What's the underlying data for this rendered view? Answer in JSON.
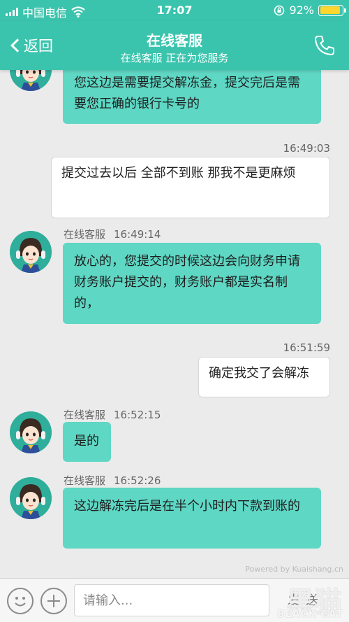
{
  "status_bar": {
    "carrier": "中国电信",
    "time": "17:07",
    "battery": "92%",
    "battery_level": 0.92
  },
  "nav": {
    "back_label": "返回",
    "title": "在线客服",
    "subtitle": "在线客服 正在为您服务"
  },
  "messages": [
    {
      "text": "您这边是需要提交解冻金，提交完后是需要您正确的银行卡号的"
    },
    {
      "time": "16:49:03",
      "text": "提交过去以后 全部不到账 那我不是更麻烦"
    },
    {
      "sender": "在线客服",
      "time": "16:49:14",
      "text": "放心的，您提交的时候这边会向财务申请财务账户提交的，财务账户都是实名制的，"
    },
    {
      "time": "16:51:59",
      "text": "确定我交了会解冻"
    },
    {
      "sender": "在线客服",
      "time": "16:52:15",
      "text": "是的"
    },
    {
      "sender": "在线客服",
      "time": "16:52:26",
      "text": "这边解冻完后是在半个小时内下款到账的"
    }
  ],
  "input_bar": {
    "placeholder": "请输入...",
    "send_label": "发送"
  },
  "watermark": {
    "powered": "Powered by Kuaishang.cn",
    "brand_cn": "黑猫",
    "brand_en": "BLACK CAT"
  },
  "colors": {
    "accent": "#3bc4ad",
    "agent_bubble": "#5ed7c4",
    "user_bubble": "#ffffff",
    "battery_fill": "#ffd630"
  },
  "icons": [
    "wifi-icon",
    "orientation-lock-icon",
    "battery-icon",
    "back-chevron-icon",
    "phone-icon",
    "emoji-icon",
    "plus-icon",
    "agent-avatar-icon"
  ]
}
